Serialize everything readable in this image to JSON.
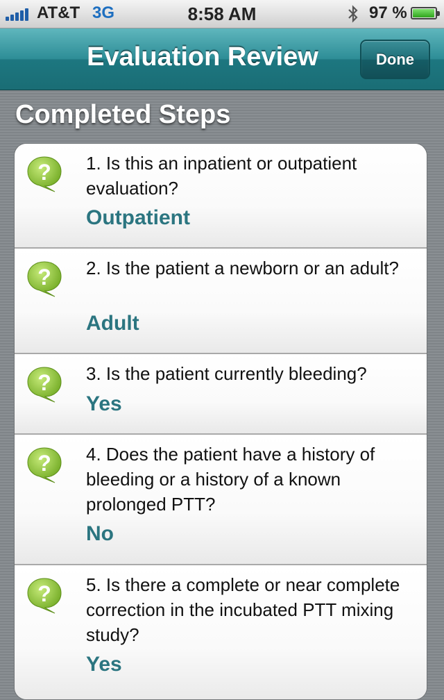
{
  "status_bar": {
    "carrier": "AT&T",
    "network": "3G",
    "time": "8:58 AM",
    "battery": "97 %",
    "battery_level": 0.97
  },
  "nav": {
    "title": "Evaluation Review",
    "done_label": "Done"
  },
  "section": {
    "title": "Completed Steps"
  },
  "steps": [
    {
      "question": "1.  Is this an inpatient or outpatient evaluation?",
      "answer": "Outpatient",
      "icon": "question-bubble-icon"
    },
    {
      "question": "2.  Is the patient a newborn or an adult?",
      "answer": "Adult",
      "icon": "question-bubble-icon"
    },
    {
      "question": "3.  Is the patient currently bleeding?",
      "answer": "Yes",
      "icon": "question-bubble-icon"
    },
    {
      "question": "4.  Does the patient have a history of bleeding or a history of a known prolonged PTT?",
      "answer": "No",
      "icon": "question-bubble-icon"
    },
    {
      "question": "5.  Is there a complete or near complete correction in the incubated PTT mixing study?",
      "answer": "Yes",
      "icon": "question-bubble-icon"
    }
  ],
  "colors": {
    "nav_teal": "#2d8d96",
    "answer_teal": "#2b7580",
    "icon_green": "#8dc63f"
  }
}
